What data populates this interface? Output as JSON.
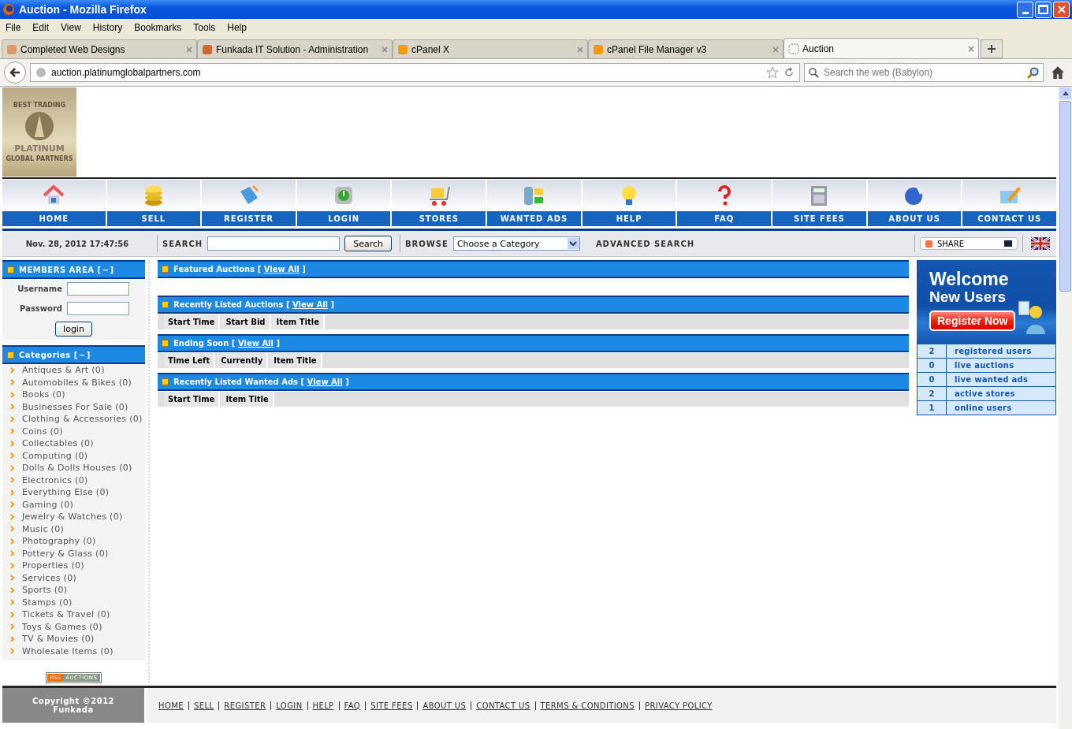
{
  "window": {
    "title": "Auction - Mozilla Firefox"
  },
  "menu": [
    "File",
    "Edit",
    "View",
    "History",
    "Bookmarks",
    "Tools",
    "Help"
  ],
  "tabs": [
    {
      "label": "Completed Web Designs",
      "selected": false
    },
    {
      "label": "Funkada IT Solution - Administration",
      "selected": false
    },
    {
      "label": "cPanel X",
      "selected": false
    },
    {
      "label": "cPanel File Manager v3",
      "selected": false
    },
    {
      "label": "Auction",
      "selected": true
    }
  ],
  "address": {
    "value": "auction.platinumglobalpartners.com"
  },
  "web_search": {
    "placeholder": "Search the web (Babylon)"
  },
  "logo": {
    "top": "BEST TRADING",
    "bottom": "PLATINUM",
    "sub": "GLOBAL PARTNERS"
  },
  "nav": [
    "HOME",
    "SELL",
    "REGISTER",
    "LOGIN",
    "STORES",
    "WANTED ADS",
    "HELP",
    "FAQ",
    "SITE FEES",
    "ABOUT US",
    "CONTACT US"
  ],
  "toolbar": {
    "date": "Nov. 28, 2012 17:47:56",
    "search_label": "SEARCH",
    "search_button": "Search",
    "browse_label": "BROWSE",
    "category": "Choose a Category",
    "advanced": "ADVANCED SEARCH",
    "share": "SHARE"
  },
  "members": {
    "title": "MEMBERS AREA [",
    "toggle": "−",
    "close": "]",
    "username": "Username",
    "password": "Password",
    "login": "login"
  },
  "categories": {
    "title": "Categories [",
    "toggle": "−",
    "close": "]",
    "items": [
      "Antiques & Art (0)",
      "Automobiles & Bikes (0)",
      "Books (0)",
      "Businesses For Sale (0)",
      "Clothing & Accessories (0)",
      "Coins (0)",
      "Collectables (0)",
      "Computing (0)",
      "Dolls & Dolls Houses (0)",
      "Electronics (0)",
      "Everything Else (0)",
      "Gaming (0)",
      "Jewelry & Watches (0)",
      "Music (0)",
      "Photography (0)",
      "Pottery & Glass (0)",
      "Properties (0)",
      "Services (0)",
      "Sports (0)",
      "Stamps (0)",
      "Tickets & Travel (0)",
      "Toys & Games (0)",
      "TV & Movies (0)",
      "Wholesale Items (0)"
    ]
  },
  "rss": {
    "left": "RSS",
    "right": "AUCTIONS"
  },
  "sections": [
    {
      "title": "Featured Auctions [",
      "link": "View All",
      "close": "]"
    },
    {
      "title": "Recently Listed Auctions [",
      "link": "View All",
      "close": "]",
      "columns": [
        "Start Time",
        "Start Bid",
        "Item Title"
      ]
    },
    {
      "title": "Ending Soon [",
      "link": "View All",
      "close": "]",
      "columns": [
        "Time Left",
        "Currently",
        "Item Title"
      ]
    },
    {
      "title": "Recently Listed Wanted Ads [",
      "link": "View All",
      "close": "]",
      "columns": [
        "Start Time",
        "Item Title"
      ]
    }
  ],
  "welcome": {
    "line1": "Welcome",
    "line2": "New Users",
    "button": "Register Now"
  },
  "stats": [
    {
      "count": "2",
      "label": "registered users"
    },
    {
      "count": "0",
      "label": "live auctions"
    },
    {
      "count": "0",
      "label": "live wanted ads"
    },
    {
      "count": "2",
      "label": "active stores"
    },
    {
      "count": "1",
      "label": "online users"
    }
  ],
  "footer": {
    "copyright": "Copyright ©2012",
    "owner": "Funkada",
    "links": [
      "HOME",
      "SELL",
      "REGISTER",
      "LOGIN",
      "HELP",
      "FAQ",
      "SITE FEES",
      "ABOUT US",
      "CONTACT US",
      "TERMS & CONDITIONS",
      "PRIVACY POLICY"
    ]
  }
}
